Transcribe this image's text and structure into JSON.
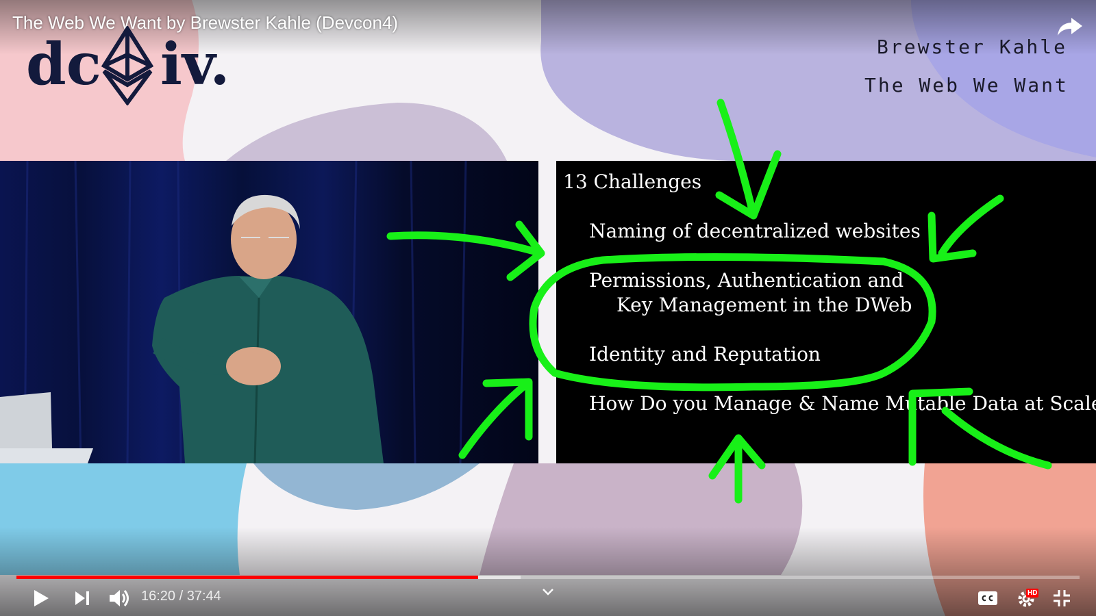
{
  "player": {
    "video_title": "The Web We Want by Brewster Kahle (Devcon4)",
    "current_time": "16:20",
    "duration": "37:44",
    "time_display": "16:20 / 37:44",
    "progress_played": 0.434,
    "progress_buffered": 0.474,
    "accent_color": "#ff0000",
    "hd_badge": "HD",
    "icons": [
      "share-icon",
      "play-icon",
      "next-icon",
      "volume-icon",
      "chevron-down-icon",
      "captions-icon",
      "settings-icon",
      "exit-fullscreen-icon"
    ]
  },
  "stage": {
    "logo_left": "dc",
    "logo_right": "iv.",
    "speaker_name": "Brewster Kahle",
    "talk_title": "The Web We Want"
  },
  "slide": {
    "heading": "13 Challenges",
    "items": [
      "Naming of decentralized websites",
      "Permissions, Authentication and",
      "Key Management in the DWeb",
      "Identity and Reputation",
      "How Do you Manage & Name Mutable Data at Scale?"
    ],
    "annotation_color": "#18f018"
  }
}
